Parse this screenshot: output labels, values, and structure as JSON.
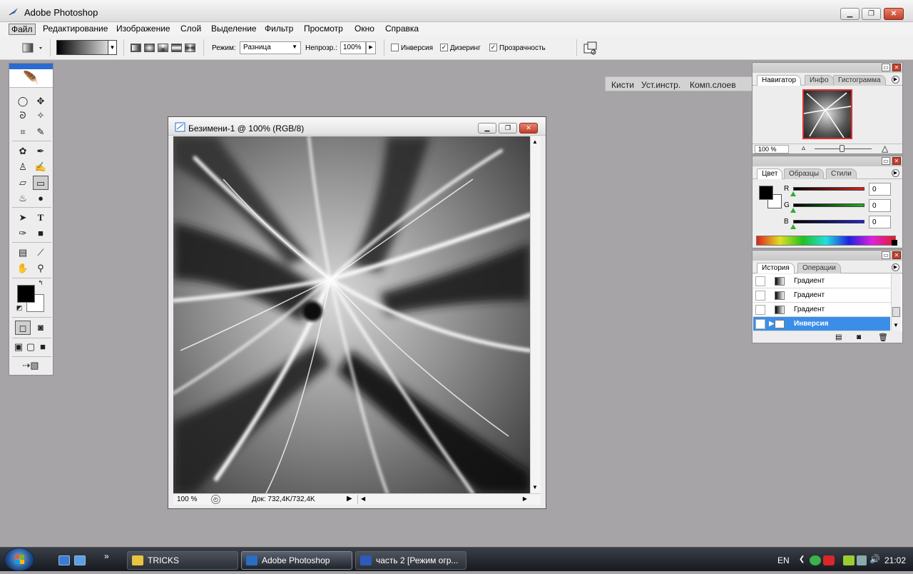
{
  "window": {
    "title": "Adobe Photoshop",
    "minimize": "▁",
    "restore": "❐",
    "close": "✕"
  },
  "menu": [
    {
      "label": "Файл",
      "active": true
    },
    {
      "label": "Редактирование"
    },
    {
      "label": "Изображение"
    },
    {
      "label": "Слой"
    },
    {
      "label": "Выделение"
    },
    {
      "label": "Фильтр"
    },
    {
      "label": "Просмотр"
    },
    {
      "label": "Окно"
    },
    {
      "label": "Справка"
    }
  ],
  "options": {
    "mode_label": "Режим:",
    "mode_value": "Разница",
    "opacity_label": "Непрозр.:",
    "opacity_value": "100%",
    "reverse_label": "Инверсия",
    "reverse_checked": false,
    "dither_label": "Дизеринг",
    "dither_checked": true,
    "transparency_label": "Прозрачность",
    "transparency_checked": true,
    "palette_well_tabs": [
      "Кисти",
      "Уст.инстр.",
      "Комп.слоев"
    ]
  },
  "document": {
    "title": "Безимени-1 @ 100% (RGB/8)",
    "zoom": "100 %",
    "doc_info": "Док: 732,4K/732,4K"
  },
  "navigator": {
    "tabs": [
      "Навигатор",
      "Инфо",
      "Гистограмма"
    ],
    "zoom": "100 %"
  },
  "color": {
    "tabs": [
      "Цвет",
      "Образцы",
      "Стили"
    ],
    "channels": [
      {
        "label": "R",
        "value": "0",
        "color": "#e02020"
      },
      {
        "label": "G",
        "value": "0",
        "color": "#20b020"
      },
      {
        "label": "B",
        "value": "0",
        "color": "#2020e0"
      }
    ]
  },
  "history": {
    "tabs": [
      "История",
      "Операции"
    ],
    "items": [
      {
        "label": "Градиент",
        "selected": false
      },
      {
        "label": "Градиент",
        "selected": false
      },
      {
        "label": "Градиент",
        "selected": false
      },
      {
        "label": "Инверсия",
        "selected": true
      }
    ]
  },
  "taskbar": {
    "buttons": [
      {
        "label": "TRICKS",
        "active": false,
        "icon_color": "#e8c440"
      },
      {
        "label": "Adobe Photoshop",
        "active": true,
        "icon_color": "#2a6ec4"
      },
      {
        "label": "часть 2 [Режим огр...",
        "active": false,
        "icon_color": "#2b5cb8"
      }
    ],
    "language": "EN",
    "clock": "21:02",
    "quick_launch_more": "»"
  }
}
